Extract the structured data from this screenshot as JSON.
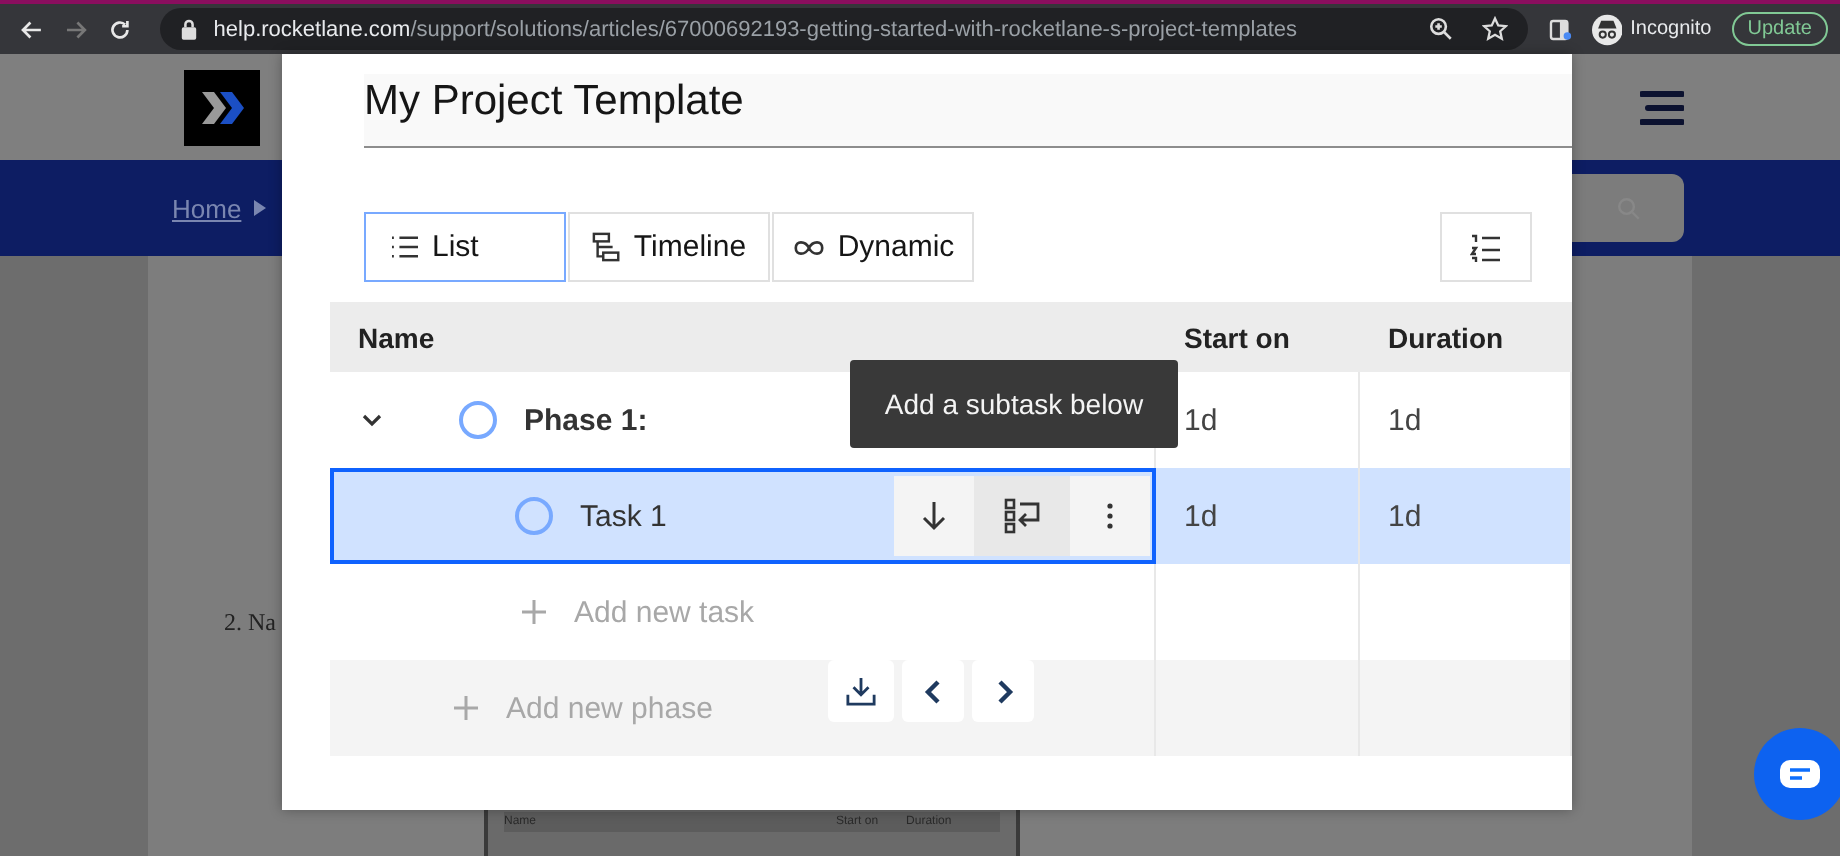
{
  "browser": {
    "url_host": "help.rocketlane.com",
    "url_path": "/support/solutions/articles/67000692193-getting-started-with-rocketlane-s-project-templates",
    "profile": "Incognito",
    "update_button": "Update"
  },
  "site": {
    "breadcrumb": "Home",
    "step_text": "2. Na",
    "embedded_columns": [
      "Name",
      "Start on",
      "Duration"
    ]
  },
  "modal": {
    "title": "My Project Template",
    "views": [
      {
        "label": "List",
        "kind": "list",
        "selected": true
      },
      {
        "label": "Timeline",
        "kind": "timeline",
        "selected": false
      },
      {
        "label": "Dynamic",
        "kind": "dynamic",
        "selected": false
      }
    ],
    "columns": [
      "Name",
      "Start on",
      "Duration"
    ],
    "rows": [
      {
        "kind": "phase",
        "name": "Phase 1:",
        "expanded": true,
        "selected": false,
        "start": "1d",
        "duration": "1d"
      },
      {
        "kind": "task",
        "name": "Task 1",
        "selected": true,
        "start": "1d",
        "duration": "1d"
      },
      {
        "kind": "add-task",
        "name": "Add new task"
      },
      {
        "kind": "add-phase",
        "name": "Add new phase"
      }
    ],
    "tooltip": "Add a subtask below"
  }
}
